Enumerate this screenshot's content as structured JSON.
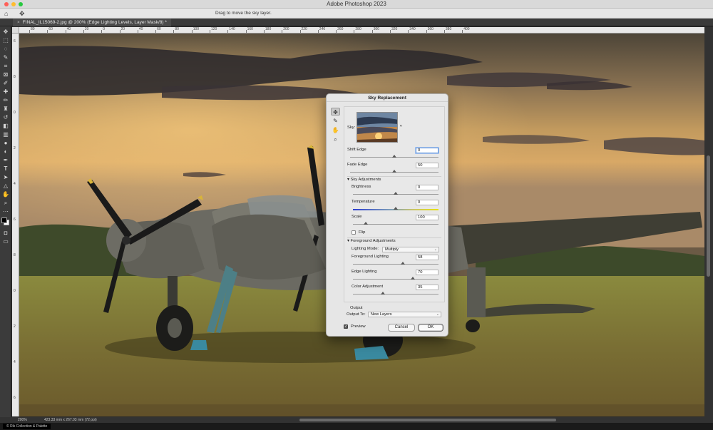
{
  "app": {
    "window_title": "Adobe Photoshop 2023",
    "traffic_colors": [
      "#ff5f57",
      "#febc2e",
      "#28c840"
    ]
  },
  "options_bar": {
    "home_icon": "home-icon",
    "move_icon": "move-tool-icon",
    "hint": "Drag to move the sky layer."
  },
  "document": {
    "tab_label": "FINAL_IL15069-2.jpg @ 200% (Edge Lighting Levels, Layer Mask/8) *",
    "close_glyph": "×"
  },
  "rulers": {
    "top_labels": [
      "80",
      "60",
      "40",
      "20",
      "0",
      "20",
      "40",
      "60",
      "80",
      "100",
      "120",
      "140",
      "160",
      "180",
      "200",
      "220",
      "240",
      "260",
      "280",
      "300",
      "320",
      "340",
      "360",
      "380",
      "400"
    ],
    "left_labels": [
      "6",
      "8",
      "0",
      "2",
      "4",
      "6",
      "8",
      "0",
      "2",
      "4",
      "6"
    ]
  },
  "toolbar": {
    "tools": [
      "move-tool-icon",
      "marquee-icon",
      "lasso-icon",
      "quick-select-icon",
      "crop-icon",
      "frame-icon",
      "eyedropper-icon",
      "spot-heal-icon",
      "brush-icon",
      "clone-stamp-icon",
      "history-brush-icon",
      "eraser-icon",
      "gradient-icon",
      "blur-icon",
      "dodge-icon",
      "pen-icon",
      "type-icon",
      "path-select-icon",
      "shape-icon",
      "hand-icon",
      "zoom-icon",
      "more-icon"
    ]
  },
  "status": {
    "zoom": "200%",
    "dimensions": "423.33 mm x 267.03 mm (72 ppi)",
    "credit": "© Rik Collection & Palette"
  },
  "dialog": {
    "title": "Sky Replacement",
    "sky_label": "Sky:",
    "shift_edge": {
      "label": "Shift Edge",
      "value": "0",
      "level": 0.5
    },
    "fade_edge": {
      "label": "Fade Edge",
      "value": "50",
      "level": 0.5
    },
    "sky_adjustments": {
      "header": "Sky Adjustments",
      "brightness": {
        "label": "Brightness",
        "value": "0",
        "level": 0.5
      },
      "temperature": {
        "label": "Temperature",
        "value": "0",
        "level": 0.5
      },
      "scale": {
        "label": "Scale",
        "value": "100",
        "level": 0.15
      },
      "flip_label": "Flip"
    },
    "foreground_adjustments": {
      "header": "Foreground Adjustments",
      "lighting_mode_label": "Lighting Mode:",
      "lighting_mode_value": "Multiply",
      "foreground_lighting": {
        "label": "Foreground Lighting",
        "value": "58",
        "level": 0.58
      },
      "edge_lighting": {
        "label": "Edge Lighting",
        "value": "70",
        "level": 0.7
      },
      "color_adjustment": {
        "label": "Color Adjustment",
        "value": "35",
        "level": 0.35
      }
    },
    "output": {
      "header": "Output",
      "output_to_label": "Output To:",
      "output_to_value": "New Layers"
    },
    "preview_label": "Preview",
    "cancel_label": "Cancel",
    "ok_label": "OK"
  }
}
